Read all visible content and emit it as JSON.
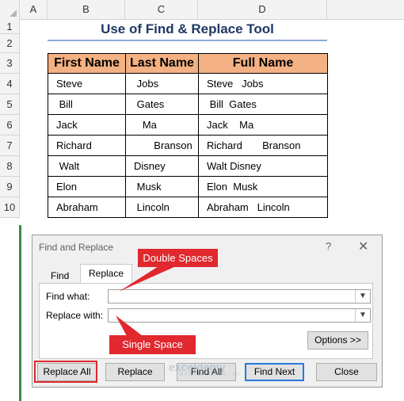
{
  "sheet": {
    "columns": [
      "A",
      "B",
      "C",
      "D"
    ],
    "rows": [
      "1",
      "2",
      "3",
      "4",
      "5",
      "6",
      "7",
      "8",
      "9",
      "10"
    ],
    "title": "Use of Find & Replace Tool",
    "table": {
      "headers": [
        "First Name",
        "Last Name",
        "Full Name"
      ],
      "rows": [
        [
          "Steve",
          " Jobs",
          "Steve   Jobs"
        ],
        [
          " Bill",
          " Gates",
          " Bill  Gates"
        ],
        [
          "Jack",
          "   Ma",
          "Jack    Ma"
        ],
        [
          "Richard",
          "       Branson",
          "Richard       Branson"
        ],
        [
          " Walt",
          "Disney",
          "Walt Disney"
        ],
        [
          "Elon",
          " Musk",
          "Elon  Musk"
        ],
        [
          "Abraham",
          " Lincoln",
          "Abraham   Lincoln"
        ]
      ]
    },
    "header_fill_color": "#f4b183"
  },
  "dialog": {
    "title": "Find and Replace",
    "help": "?",
    "close": "✕",
    "tabs": [
      "Find",
      "Replace"
    ],
    "active_tab": "Replace",
    "find_label": "Find what:",
    "replace_label": "Replace with:",
    "find_value": "",
    "replace_value": "",
    "options_button": "Options >>",
    "buttons": {
      "replace_all": "Replace All",
      "replace": "Replace",
      "find_all": "Find All",
      "find_next": "Find Next",
      "close": "Close"
    }
  },
  "annotations": {
    "double_spaces": "Double Spaces",
    "single_space": "Single Space",
    "highlight_color": "#e0282e"
  },
  "watermark": {
    "name": "exceldemy",
    "tagline": "EXCEL · DATA · BI"
  }
}
